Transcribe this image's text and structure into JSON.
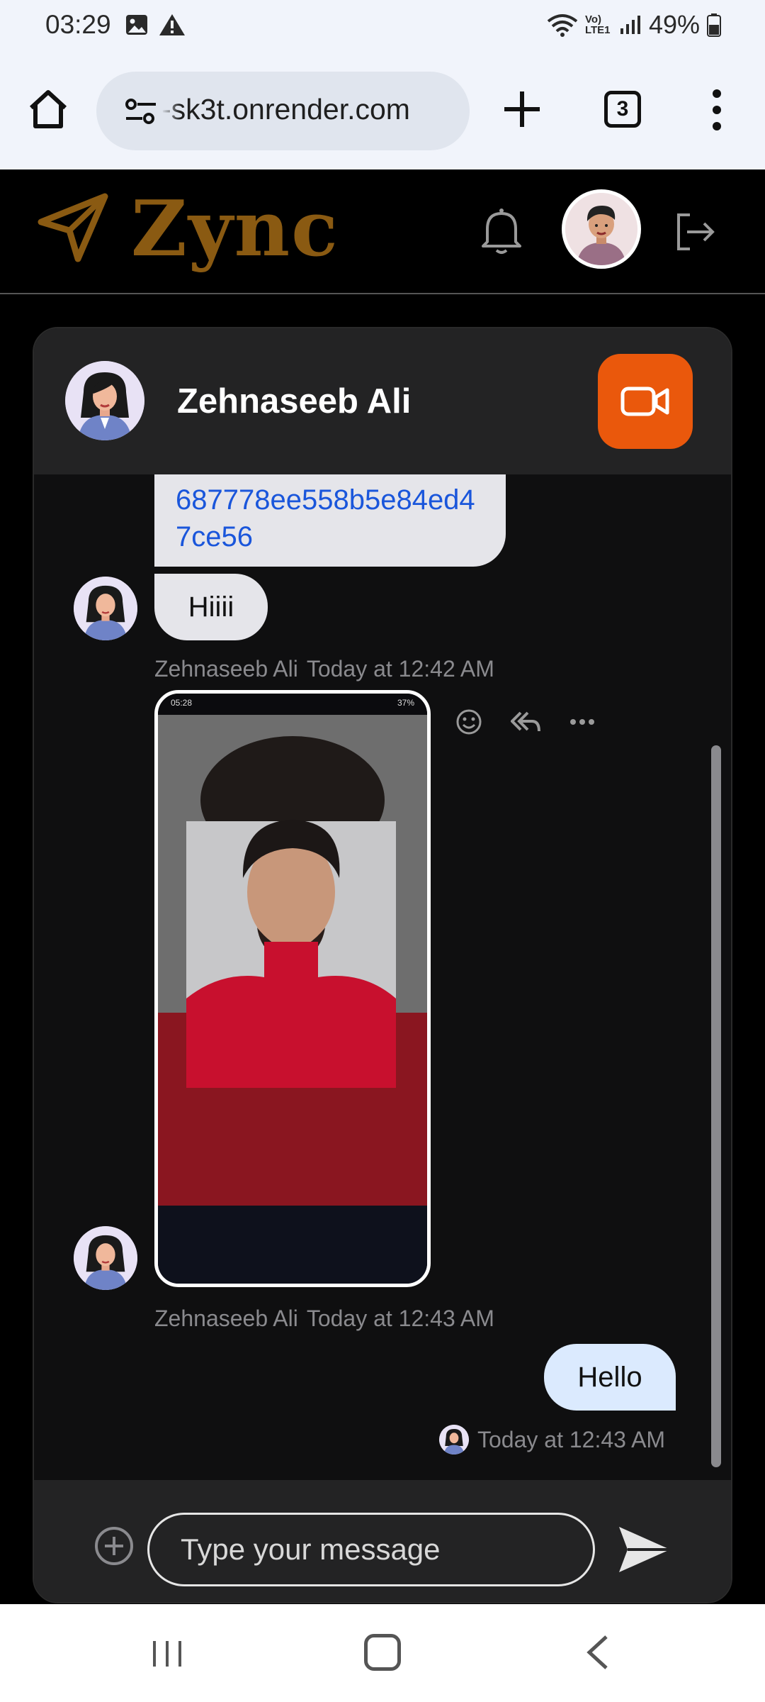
{
  "status_bar": {
    "time": "03:29",
    "network_label": "Vo) LTE1",
    "battery": "49%"
  },
  "browser": {
    "url": "-sk3t.onrender.com",
    "tab_count": "3"
  },
  "app": {
    "logo_text": "Zync",
    "brand_color": "#8a5a12",
    "accent_color": "#ea580c"
  },
  "chat": {
    "contact_name": "Zehnaseeb Ali",
    "messages": [
      {
        "type": "text-link",
        "text": "687778ee558b5e84ed47ce56"
      },
      {
        "type": "text",
        "text": "Hiiii",
        "sender": "Zehnaseeb Ali",
        "time": "Today at 12:42 AM"
      },
      {
        "type": "image",
        "sender": "Zehnaseeb Ali",
        "time": "Today at 12:43 AM"
      },
      {
        "type": "text",
        "outgoing": true,
        "text": "Hello",
        "time": "Today at 12:43 AM"
      }
    ],
    "image_tools": [
      "emoji-icon",
      "reply-all-icon",
      "more-icon"
    ],
    "composer": {
      "placeholder": "Type your message"
    }
  }
}
